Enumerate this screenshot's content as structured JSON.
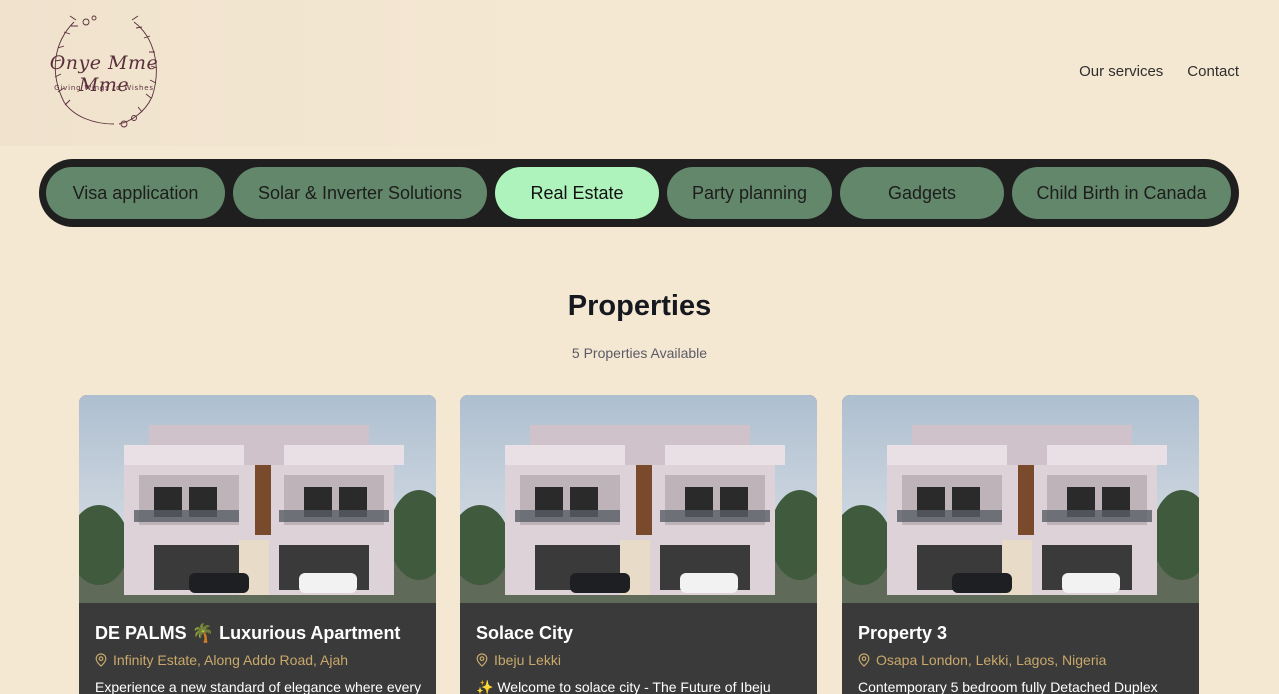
{
  "header": {
    "logo": {
      "name": "Onye Mme Mme",
      "tagline": "Giving Wings to Wishes"
    },
    "nav": [
      {
        "label": "Our services"
      },
      {
        "label": "Contact"
      }
    ]
  },
  "categories": [
    {
      "label": "Visa application",
      "active": false
    },
    {
      "label": "Solar & Inverter Solutions",
      "active": false
    },
    {
      "label": "Real Estate",
      "active": true
    },
    {
      "label": "Party planning",
      "active": false
    },
    {
      "label": "Gadgets",
      "active": false
    },
    {
      "label": "Child Birth in Canada",
      "active": false
    }
  ],
  "section": {
    "title": "Properties",
    "subtitle": "5 Properties Available"
  },
  "properties": [
    {
      "title": "DE PALMS 🌴 Luxurious Apartment",
      "location": "Infinity Estate, Along Addo Road, Ajah",
      "description": "Experience a new standard of elegance where every"
    },
    {
      "title": "Solace City",
      "location": "Ibeju Lekki",
      "description": "✨ Welcome to solace city - The Future of Ibeju"
    },
    {
      "title": "Property 3",
      "location": "Osapa London, Lekki, Lagos, Nigeria",
      "description": "Contemporary 5 bedroom fully Detached Duplex"
    }
  ],
  "colors": {
    "background": "#f5e8d3",
    "category_bar": "#1f1f1f",
    "pill": "#63876a",
    "pill_active": "#aef2bc",
    "card": "#3a3a3a",
    "location": "#c9a96b"
  },
  "icons": {
    "location": "map-pin-icon"
  }
}
